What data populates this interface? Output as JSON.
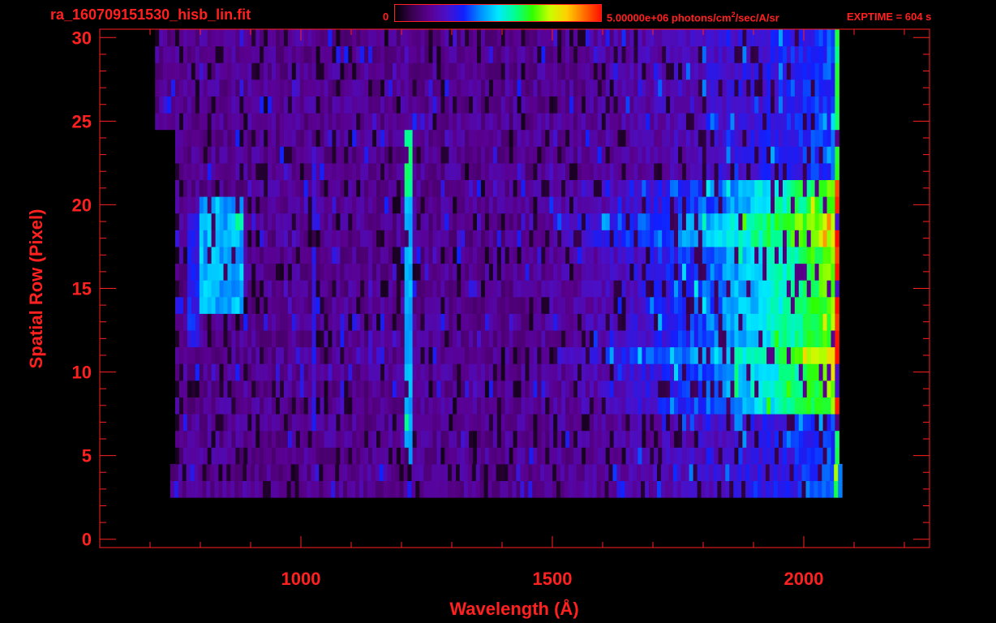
{
  "header": {
    "file_title": "ra_160709151530_hisb_lin.fit",
    "colorbar_min": "0",
    "colorbar_max_prefix": "5.00000e+06 photons/cm",
    "colorbar_max_sup": "2",
    "colorbar_max_suffix": "/sec/A/sr",
    "exptime": "EXPTIME = 604 s"
  },
  "colors": {
    "axis": "#ff2020",
    "background": "#000000",
    "colormap": [
      "#000000",
      "#3a0050",
      "#5a0090",
      "#4a10c8",
      "#1020ff",
      "#0090ff",
      "#00e8ff",
      "#00ff90",
      "#30ff00",
      "#c8ff00",
      "#ffd000",
      "#ff7000",
      "#ff1000"
    ]
  },
  "chart_data": {
    "type": "heatmap",
    "title": "",
    "xlabel": "Wavelength (Å)",
    "ylabel": "Spatial Row (Pixel)",
    "xlim": [
      600,
      2250
    ],
    "ylim": [
      -0.5,
      30.5
    ],
    "xticks": [
      1000,
      1500,
      2000
    ],
    "yticks": [
      0,
      5,
      10,
      15,
      20,
      25,
      30
    ],
    "color_range": [
      0,
      5000000
    ],
    "data_extent_x": [
      750,
      2100
    ],
    "data_rows": [
      3,
      30
    ],
    "features": [
      {
        "wavelength": 1216,
        "rows": [
          5,
          24
        ],
        "description": "bright vertical emission line"
      },
      {
        "wavelength": 1026,
        "rows": [
          7,
          23
        ],
        "description": "weak emission line"
      },
      {
        "wavelength_range": [
          800,
          880
        ],
        "rows": [
          14,
          20
        ],
        "description": "bright band"
      },
      {
        "wavelength_range": [
          1700,
          2070
        ],
        "rows": [
          8,
          21
        ],
        "description": "bright continuum"
      }
    ]
  }
}
